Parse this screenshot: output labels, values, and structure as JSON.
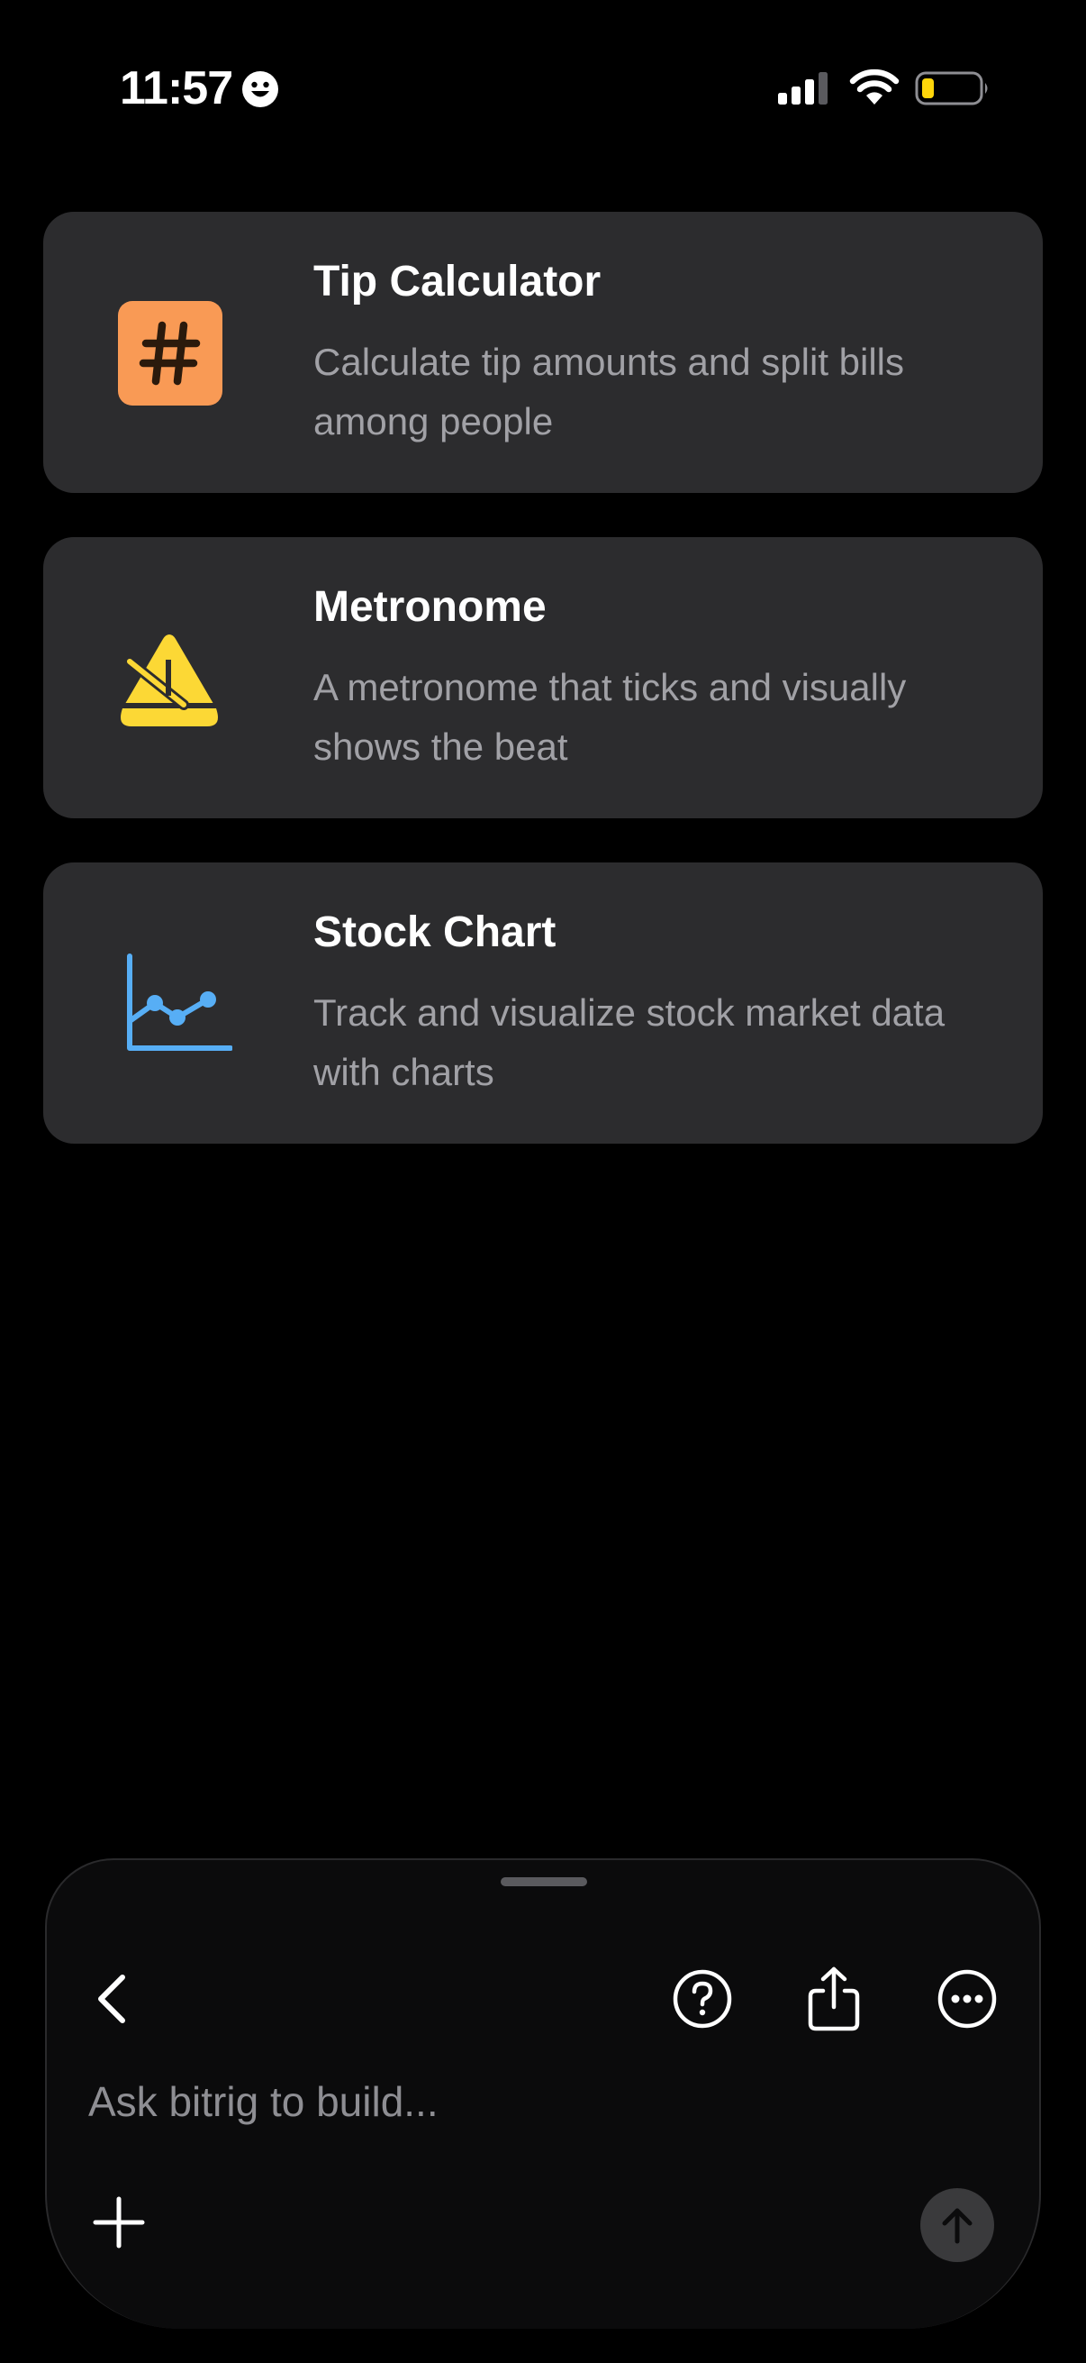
{
  "status_bar": {
    "time": "11:57",
    "battery_color": "#ffd60a"
  },
  "apps": [
    {
      "title": "Tip Calculator",
      "description": "Calculate tip amounts and split bills among people",
      "icon": "hash-icon",
      "icon_color": "#f99a55"
    },
    {
      "title": "Metronome",
      "description": "A metronome that ticks and visually shows the beat",
      "icon": "metronome-icon",
      "icon_color": "#fcd835"
    },
    {
      "title": "Stock Chart",
      "description": "Track and visualize stock market data with charts",
      "icon": "line-chart-icon",
      "icon_color": "#57aef5"
    }
  ],
  "composer": {
    "placeholder": "Ask bitrig to build...",
    "value": "",
    "icons": [
      "chevron-left-icon",
      "question-circle-icon",
      "share-icon",
      "ellipsis-circle-icon",
      "plus-icon",
      "arrow-up-icon"
    ]
  }
}
